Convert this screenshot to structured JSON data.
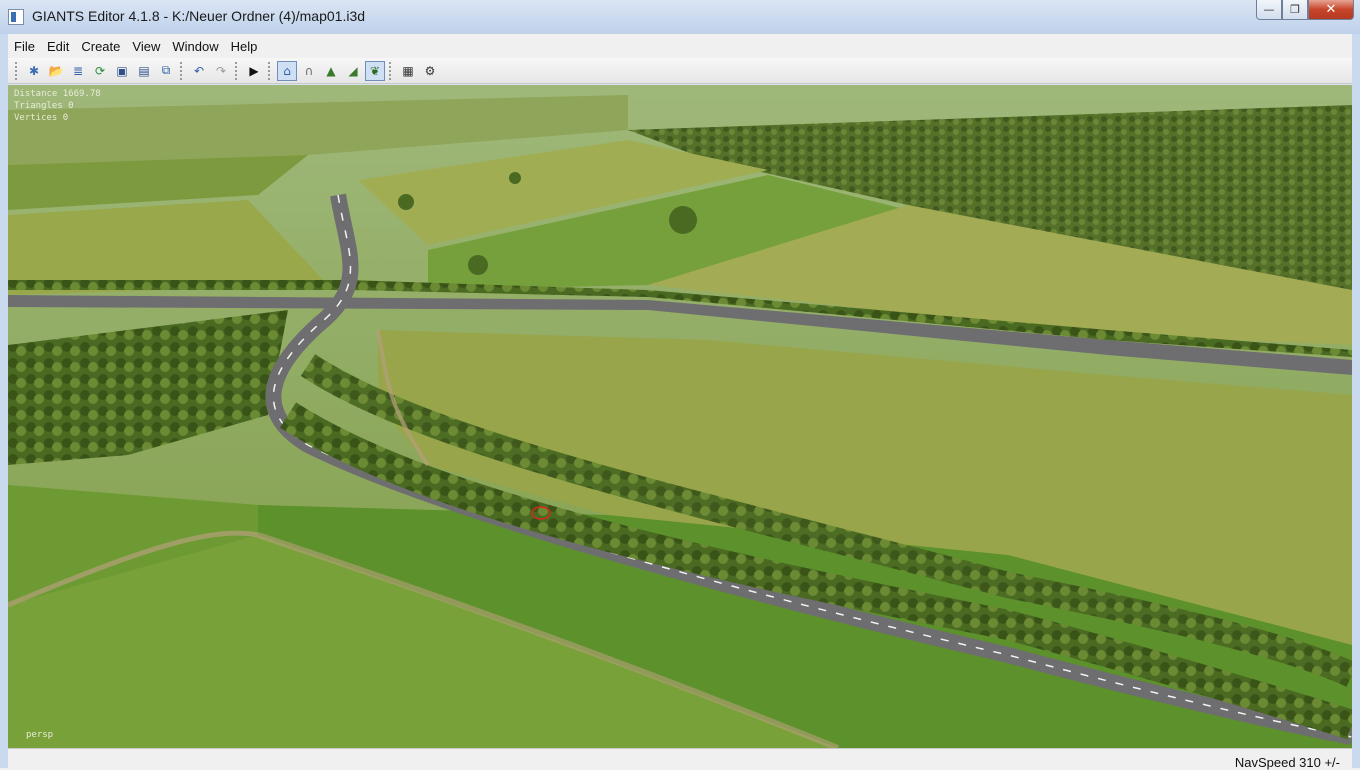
{
  "window": {
    "title": "GIANTS Editor 4.1.8 - K:/Neuer Ordner (4)/map01.i3d",
    "buttons": {
      "minimize": "—",
      "maximize": "❐",
      "close": "✕"
    }
  },
  "menu": [
    {
      "label": "File"
    },
    {
      "label": "Edit"
    },
    {
      "label": "Create"
    },
    {
      "label": "View"
    },
    {
      "label": "Window"
    },
    {
      "label": "Help"
    }
  ],
  "toolbar": {
    "items": [
      {
        "icon": "new-scene-icon",
        "glyph": "✱",
        "color": "#3b6db3"
      },
      {
        "icon": "open-icon",
        "glyph": "📂",
        "color": "#c8a227"
      },
      {
        "icon": "import-icon",
        "glyph": "≣",
        "color": "#2f5fa8"
      },
      {
        "icon": "refresh-icon",
        "glyph": "⟳",
        "color": "#2a8a3a"
      },
      {
        "icon": "save-icon",
        "glyph": "▣",
        "color": "#2d4f8a"
      },
      {
        "icon": "save-all-icon",
        "glyph": "▤",
        "color": "#2d4f8a"
      },
      {
        "icon": "export-icon",
        "glyph": "⧉",
        "color": "#2f5fa8"
      },
      {
        "icon": "undo-icon",
        "glyph": "↶",
        "color": "#2f5fa8"
      },
      {
        "icon": "redo-icon",
        "glyph": "↷",
        "color": "#9a9a9a"
      },
      {
        "icon": "play-icon",
        "glyph": "▶",
        "color": "#111111"
      },
      {
        "icon": "select-mode-icon",
        "glyph": "⌂",
        "color": "#2f5fa8",
        "active": true
      },
      {
        "icon": "terrain-sculpt-icon",
        "glyph": "∩",
        "color": "#6a6a6a"
      },
      {
        "icon": "terrain-paint-icon",
        "glyph": "▲",
        "color": "#3a7a2a"
      },
      {
        "icon": "foliage-paint-icon",
        "glyph": "◢",
        "color": "#3a7a2a"
      },
      {
        "icon": "foliage-mode-icon",
        "glyph": "❦",
        "color": "#2a6a1a",
        "active": true
      },
      {
        "icon": "checker-icon",
        "glyph": "▦",
        "color": "#333333"
      },
      {
        "icon": "gear-checker-icon",
        "glyph": "⚙",
        "color": "#333333"
      }
    ]
  },
  "viewport": {
    "stats": [
      "Distance 1669.78",
      "Triangles 0",
      "Vertices 0"
    ],
    "camera_label": "persp"
  },
  "statusbar": {
    "nav_speed": "NavSpeed 310 +/-"
  },
  "colors": {
    "accent": "#3b6db3",
    "field_light": "#8aa23e",
    "field_dark": "#5f8a2a",
    "forest": "#4e6a24",
    "road": "#6e6e70"
  }
}
